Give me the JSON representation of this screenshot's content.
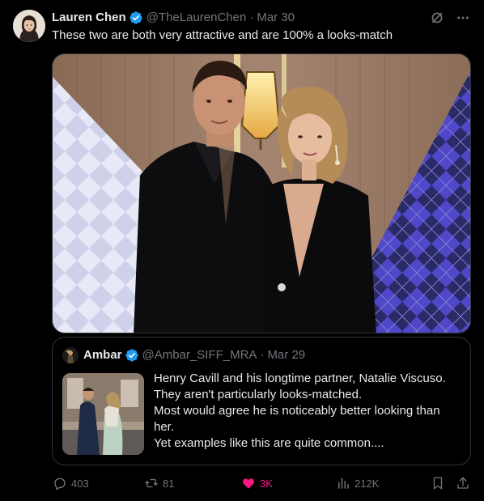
{
  "tweet": {
    "author_name": "Lauren Chen",
    "handle": "@TheLaurenChen",
    "separator": "·",
    "date": "Mar 30",
    "text": "These two are both very attractive and are 100% a looks-match",
    "verified": true
  },
  "quote": {
    "author_name": "Ambar",
    "handle": "@Ambar_SIFF_MRA",
    "separator": "·",
    "date": "Mar 29",
    "verified": true,
    "lines": [
      "Henry Cavill and his longtime partner, Natalie Viscuso.",
      "They aren't particularly looks-matched.",
      "Most would agree he is noticeably better looking than",
      "her.",
      "Yet examples like this are quite common...."
    ]
  },
  "actions": {
    "replies": "403",
    "reposts": "81",
    "likes": "3K",
    "views": "212K",
    "liked": true
  },
  "icons": {
    "verified": "verified-badge-icon",
    "grok": "grok-icon",
    "more": "more-icon",
    "reply": "reply-icon",
    "repost": "repost-icon",
    "like": "heart-icon",
    "views": "views-icon",
    "bookmark": "bookmark-icon",
    "share": "share-icon"
  },
  "colors": {
    "background": "#000000",
    "text": "#e7e9ea",
    "muted": "#71767b",
    "border": "#2f3336",
    "verified": "#1d9bf0",
    "like": "#f91880"
  }
}
